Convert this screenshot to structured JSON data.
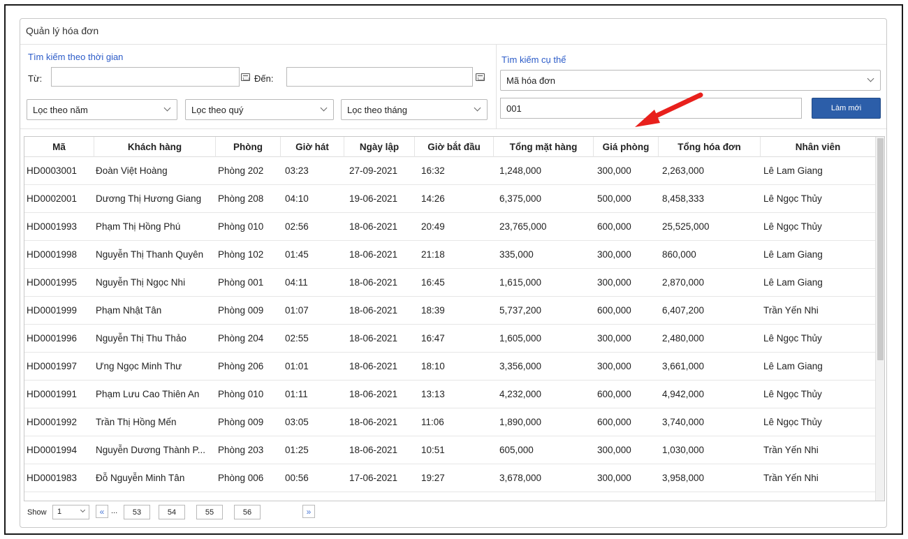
{
  "panel": {
    "title": "Quản lý hóa đơn"
  },
  "time_search": {
    "section_label": "Tìm kiếm theo thời gian",
    "from_label": "Từ:",
    "from_value": "",
    "to_label": "Đến:",
    "to_value": "",
    "year_filter": "Lọc theo năm",
    "quarter_filter": "Lọc theo quý",
    "month_filter": "Lọc theo tháng"
  },
  "specific_search": {
    "section_label": "Tìm kiếm cụ thể",
    "field_select": "Mã hóa đơn",
    "query": "001",
    "refresh_label": "Làm mới"
  },
  "table": {
    "headers": [
      "Mã",
      "Khách hàng",
      "Phòng",
      "Giờ hát",
      "Ngày lập",
      "Giờ bắt đầu",
      "Tổng mặt hàng",
      "Giá phòng",
      "Tổng hóa đơn",
      "Nhân viên"
    ],
    "rows": [
      [
        "HD0003001",
        "Đoàn Việt Hoàng",
        "Phòng 202",
        "03:23",
        "27-09-2021",
        "16:32",
        "1,248,000",
        "300,000",
        "2,263,000",
        "Lê Lam Giang"
      ],
      [
        "HD0002001",
        "Dương Thị Hương Giang",
        "Phòng 208",
        "04:10",
        "19-06-2021",
        "14:26",
        "6,375,000",
        "500,000",
        "8,458,333",
        "Lê Ngọc Thủy"
      ],
      [
        "HD0001993",
        "Phạm Thị Hồng Phú",
        "Phòng 010",
        "02:56",
        "18-06-2021",
        "20:49",
        "23,765,000",
        "600,000",
        "25,525,000",
        "Lê Ngọc Thủy"
      ],
      [
        "HD0001998",
        "Nguyễn Thị Thanh Quyên",
        "Phòng 102",
        "01:45",
        "18-06-2021",
        "21:18",
        "335,000",
        "300,000",
        "860,000",
        "Lê Lam Giang"
      ],
      [
        "HD0001995",
        "Nguyễn Thị Ngọc Nhi",
        "Phòng 001",
        "04:11",
        "18-06-2021",
        "16:45",
        "1,615,000",
        "300,000",
        "2,870,000",
        "Lê Lam Giang"
      ],
      [
        "HD0001999",
        "Phạm Nhật Tân",
        "Phòng 009",
        "01:07",
        "18-06-2021",
        "18:39",
        "5,737,200",
        "600,000",
        "6,407,200",
        "Trần Yến Nhi"
      ],
      [
        "HD0001996",
        "Nguyễn Thị Thu Thảo",
        "Phòng 204",
        "02:55",
        "18-06-2021",
        "16:47",
        "1,605,000",
        "300,000",
        "2,480,000",
        "Lê Ngọc Thủy"
      ],
      [
        "HD0001997",
        "Ưng Ngọc Minh Thư",
        "Phòng 206",
        "01:01",
        "18-06-2021",
        "18:10",
        "3,356,000",
        "300,000",
        "3,661,000",
        "Lê Lam Giang"
      ],
      [
        "HD0001991",
        "Phạm Lưu Cao Thiên An",
        "Phòng 010",
        "01:11",
        "18-06-2021",
        "13:13",
        "4,232,000",
        "600,000",
        "4,942,000",
        "Lê Ngọc Thủy"
      ],
      [
        "HD0001992",
        "Trần Thị Hồng Mến",
        "Phòng 009",
        "03:05",
        "18-06-2021",
        "11:06",
        "1,890,000",
        "600,000",
        "3,740,000",
        "Lê Ngọc Thủy"
      ],
      [
        "HD0001994",
        "Nguyễn Dương Thành P...",
        "Phòng 203",
        "01:25",
        "18-06-2021",
        "10:51",
        "605,000",
        "300,000",
        "1,030,000",
        "Trần Yến Nhi"
      ],
      [
        "HD0001983",
        "Đỗ Nguyễn Minh Tân",
        "Phòng 006",
        "00:56",
        "17-06-2021",
        "19:27",
        "3,678,000",
        "300,000",
        "3,958,000",
        "Trần Yến Nhi"
      ]
    ]
  },
  "pager": {
    "show_label": "Show",
    "page_size": "1",
    "first_icon": "«",
    "ellipsis": "...",
    "pages": [
      "53",
      "54",
      "55",
      "56"
    ],
    "next_icon": "»"
  },
  "icons": {
    "calendar": "calendar-icon",
    "chevron": "chevron-down-icon",
    "annotation": "red-arrow"
  },
  "colors": {
    "accent": "#2c5ea9",
    "section_label": "#2b5bc8",
    "annotation_arrow": "#e8201c"
  }
}
